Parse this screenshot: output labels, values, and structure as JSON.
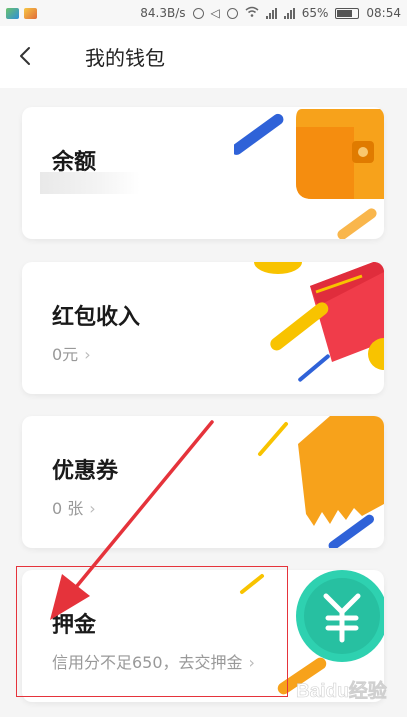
{
  "status_bar": {
    "speed": "84.3B/s",
    "battery_percent": "65%",
    "battery_level": 0.65,
    "time": "08:54"
  },
  "header": {
    "title": "我的钱包"
  },
  "cards": [
    {
      "name": "余额",
      "sub": ""
    },
    {
      "name": "红包收入",
      "sub": "0元"
    },
    {
      "name": "优惠券",
      "sub": "0 张"
    },
    {
      "name": "押金",
      "sub": "信用分不足650，去交押金"
    }
  ],
  "chevron": "›",
  "watermark": {
    "text": "Baidu经验"
  },
  "colors": {
    "annotation": "#e5333b",
    "orange": "#f7a21b",
    "blue": "#2f62d8",
    "red": "#f03c4a",
    "yellow": "#f8c300",
    "teal": "#2ed1b0"
  }
}
